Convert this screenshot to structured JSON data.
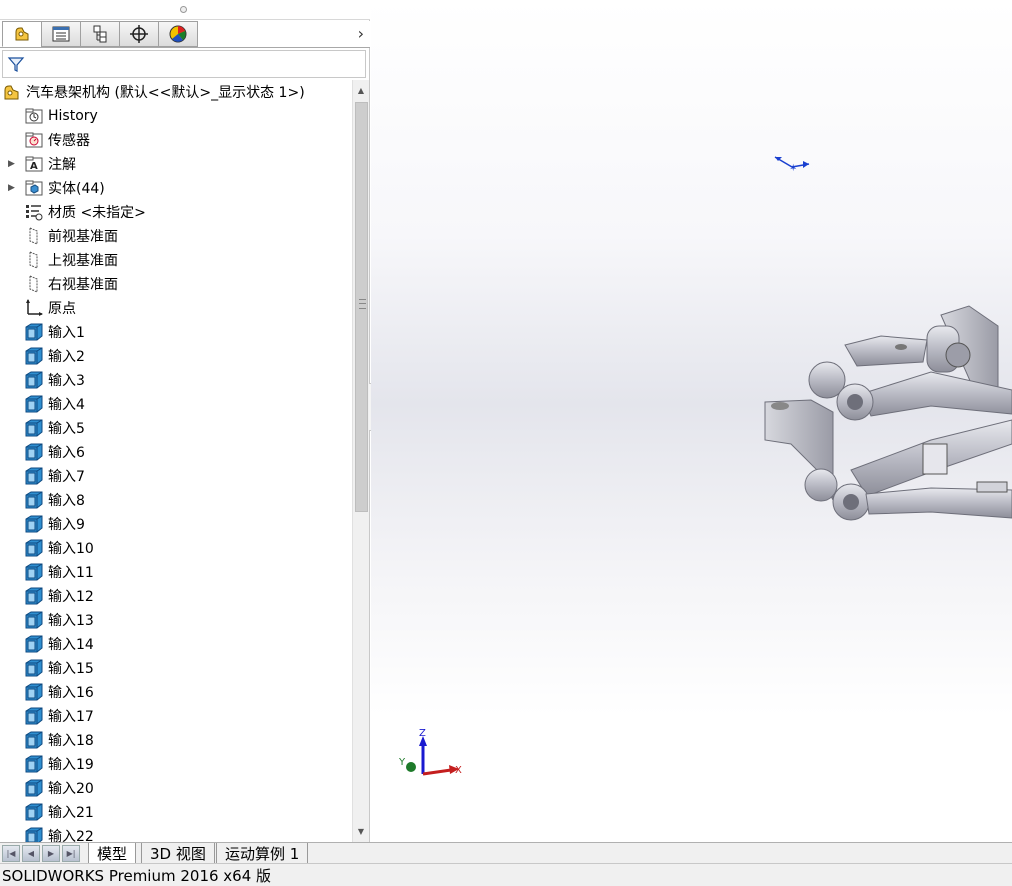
{
  "feature_tree": {
    "root": {
      "label": "汽车悬架机构  (默认<<默认>_显示状态 1>)"
    },
    "items": [
      {
        "label": "History",
        "icon": "history-folder-icon",
        "expandable": false
      },
      {
        "label": "传感器",
        "icon": "sensor-folder-icon",
        "expandable": false
      },
      {
        "label": "注解",
        "icon": "annotation-folder-icon",
        "expandable": true
      },
      {
        "label": "实体(44)",
        "icon": "solid-bodies-folder-icon",
        "expandable": true
      },
      {
        "label": "材质 <未指定>",
        "icon": "material-icon",
        "expandable": false
      },
      {
        "label": "前视基准面",
        "icon": "plane-icon",
        "expandable": false
      },
      {
        "label": "上视基准面",
        "icon": "plane-icon",
        "expandable": false
      },
      {
        "label": "右视基准面",
        "icon": "plane-icon",
        "expandable": false
      },
      {
        "label": "原点",
        "icon": "origin-icon",
        "expandable": false
      },
      {
        "label": "输入1",
        "icon": "import-body-icon",
        "expandable": false
      },
      {
        "label": "输入2",
        "icon": "import-body-icon",
        "expandable": false
      },
      {
        "label": "输入3",
        "icon": "import-body-icon",
        "expandable": false
      },
      {
        "label": "输入4",
        "icon": "import-body-icon",
        "expandable": false
      },
      {
        "label": "输入5",
        "icon": "import-body-icon",
        "expandable": false
      },
      {
        "label": "输入6",
        "icon": "import-body-icon",
        "expandable": false
      },
      {
        "label": "输入7",
        "icon": "import-body-icon",
        "expandable": false
      },
      {
        "label": "输入8",
        "icon": "import-body-icon",
        "expandable": false
      },
      {
        "label": "输入9",
        "icon": "import-body-icon",
        "expandable": false
      },
      {
        "label": "输入10",
        "icon": "import-body-icon",
        "expandable": false
      },
      {
        "label": "输入11",
        "icon": "import-body-icon",
        "expandable": false
      },
      {
        "label": "输入12",
        "icon": "import-body-icon",
        "expandable": false
      },
      {
        "label": "输入13",
        "icon": "import-body-icon",
        "expandable": false
      },
      {
        "label": "输入14",
        "icon": "import-body-icon",
        "expandable": false
      },
      {
        "label": "输入15",
        "icon": "import-body-icon",
        "expandable": false
      },
      {
        "label": "输入16",
        "icon": "import-body-icon",
        "expandable": false
      },
      {
        "label": "输入17",
        "icon": "import-body-icon",
        "expandable": false
      },
      {
        "label": "输入18",
        "icon": "import-body-icon",
        "expandable": false
      },
      {
        "label": "输入19",
        "icon": "import-body-icon",
        "expandable": false
      },
      {
        "label": "输入20",
        "icon": "import-body-icon",
        "expandable": false
      },
      {
        "label": "输入21",
        "icon": "import-body-icon",
        "expandable": false
      },
      {
        "label": "输入22",
        "icon": "import-body-icon",
        "expandable": false
      }
    ]
  },
  "panel_tabs": [
    {
      "icon": "feature-manager-icon",
      "active": true
    },
    {
      "icon": "property-manager-icon",
      "active": false
    },
    {
      "icon": "configuration-manager-icon",
      "active": false
    },
    {
      "icon": "dimxpert-icon",
      "active": false
    },
    {
      "icon": "display-manager-icon",
      "active": false
    }
  ],
  "triad": {
    "x": "X",
    "y": "Y",
    "z": "Z"
  },
  "bottom_tabs": [
    {
      "label": "模型",
      "active": true
    },
    {
      "label": "3D 视图",
      "active": false
    },
    {
      "label": "运动算例 1",
      "active": false
    }
  ],
  "status": {
    "text": "SOLIDWORKS Premium 2016 x64 版"
  },
  "colors": {
    "accent_blue": "#1a5fb4",
    "part_gray": "#b9bac4"
  }
}
